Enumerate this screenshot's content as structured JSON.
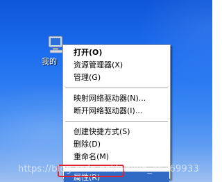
{
  "desktop": {
    "icon_name": "my-computer-icon",
    "icon_label": "我的"
  },
  "context_menu": {
    "groups": [
      [
        {
          "label": "打开(O)",
          "bold": true
        },
        {
          "label": "资源管理器(X)"
        },
        {
          "label": "管理(G)"
        }
      ],
      [
        {
          "label": "映射网络驱动器(N)..."
        },
        {
          "label": "断开网络驱动器(I)..."
        }
      ],
      [
        {
          "label": "创建快捷方式(S)"
        },
        {
          "label": "删除(D)"
        },
        {
          "label": "重命名(M)"
        }
      ],
      [
        {
          "label": "属性(R)",
          "highlighted": true
        }
      ]
    ]
  },
  "watermark": "https://blog.csdn.net/weixin_46169933",
  "colors": {
    "highlight": "#316ac5",
    "annotation_box": "#e0232e"
  }
}
